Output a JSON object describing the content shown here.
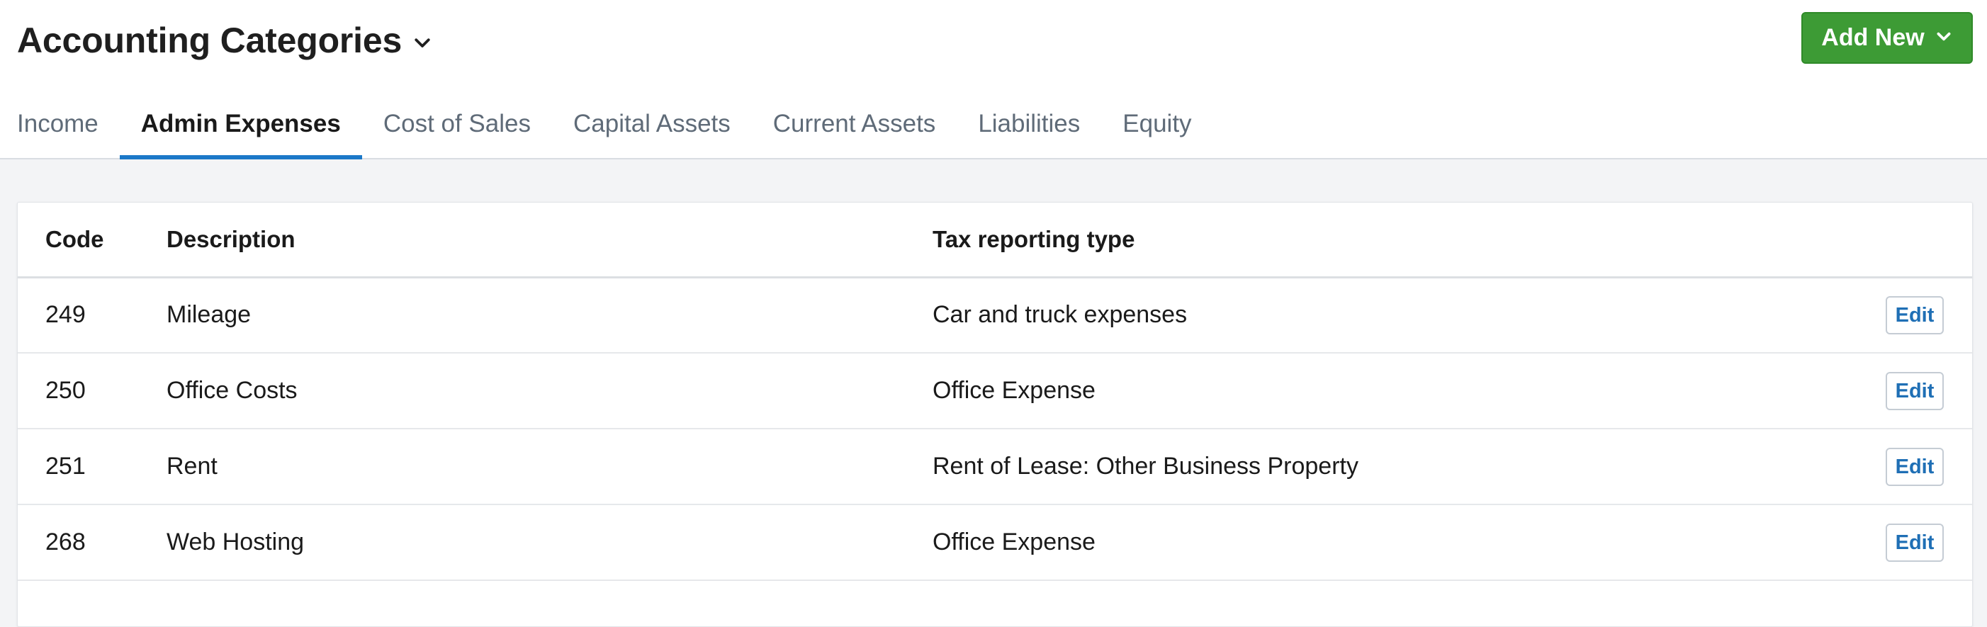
{
  "header": {
    "title": "Accounting Categories",
    "add_new_label": "Add New"
  },
  "tabs": [
    {
      "label": "Income"
    },
    {
      "label": "Admin Expenses"
    },
    {
      "label": "Cost of Sales"
    },
    {
      "label": "Capital Assets"
    },
    {
      "label": "Current Assets"
    },
    {
      "label": "Liabilities"
    },
    {
      "label": "Equity"
    }
  ],
  "active_tab": "Admin Expenses",
  "table": {
    "columns": [
      "Code",
      "Description",
      "Tax reporting type"
    ],
    "rows": [
      {
        "code": "249",
        "description": "Mileage",
        "tax_type": "Car and truck expenses",
        "action": "Edit"
      },
      {
        "code": "250",
        "description": "Office Costs",
        "tax_type": "Office Expense",
        "action": "Edit"
      },
      {
        "code": "251",
        "description": "Rent",
        "tax_type": "Rent of Lease: Other Business Property",
        "action": "Edit"
      },
      {
        "code": "268",
        "description": "Web Hosting",
        "tax_type": "Office Expense",
        "action": "Edit"
      }
    ]
  },
  "colors": {
    "primary_button": "#3d9b35",
    "active_tab_underline": "#1b78c8",
    "link": "#1f6fb5"
  },
  "icons": {
    "title_dropdown": "chevron-down-icon",
    "add_new_dropdown": "chevron-down-icon"
  }
}
